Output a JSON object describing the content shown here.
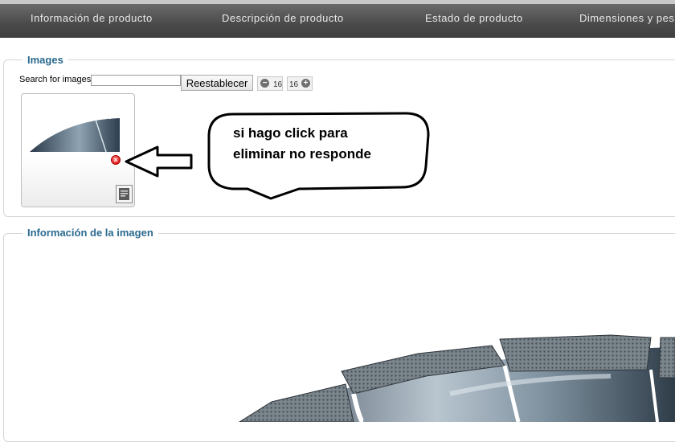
{
  "nav": {
    "tabs": [
      "Información de producto",
      "Descripción de producto",
      "Estado de producto",
      "Dimensiones y pes"
    ]
  },
  "images_section": {
    "legend": "Images",
    "search_label": "Search for images",
    "search_value": "",
    "reset_label": "Reestablecer",
    "zoom_out_value": "16",
    "zoom_in_value": "16"
  },
  "thumbnail": {
    "delete_icon": "delete-icon",
    "edit_icon": "edit-icon"
  },
  "annotation": {
    "line1": "si hago click para",
    "line2": "eliminar no responde"
  },
  "image_info_section": {
    "legend": "Información de la imagen"
  },
  "colors": {
    "legend_blue": "#2b6a8f",
    "nav_bar": "#4a4a4a",
    "delete_red": "#d40000"
  }
}
